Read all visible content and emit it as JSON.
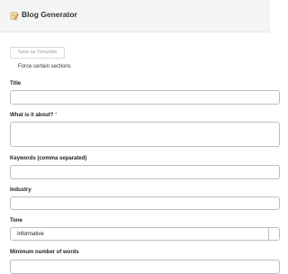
{
  "header": {
    "icon": "notepad-pencil-icon",
    "title": "Blog Generator"
  },
  "actions": {
    "save_template_label": "Save as Template"
  },
  "options": {
    "force_sections_label": "Force certain sections"
  },
  "form": {
    "title_label": "Title",
    "about_label": "What is it about?",
    "about_required_mark": "*",
    "keywords_label": "Keywords (comma separated)",
    "industry_label": "Industry",
    "tone_label": "Tone",
    "tone_value": "Informative",
    "min_words_label": "Minimum number of words"
  }
}
